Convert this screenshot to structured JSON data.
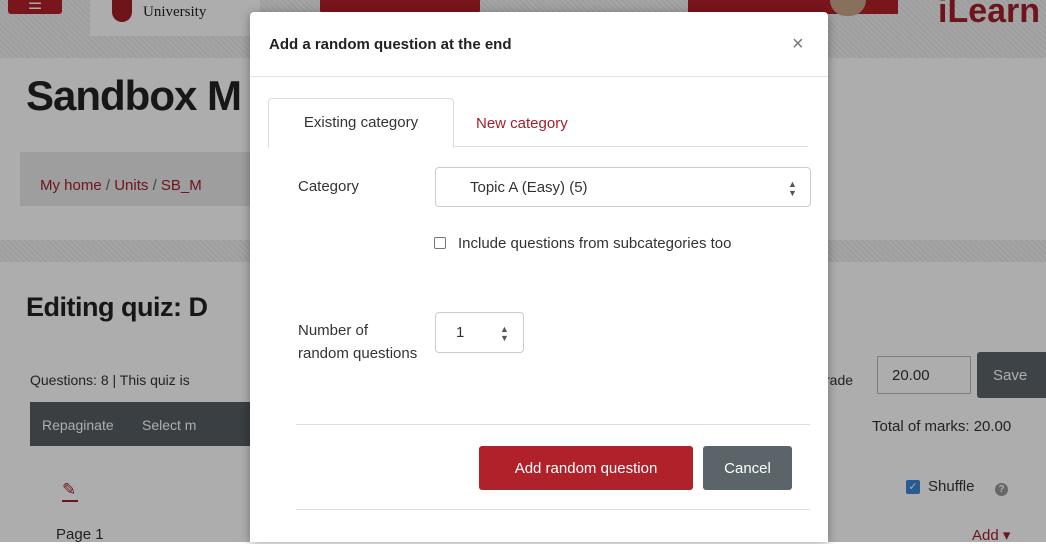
{
  "background": {
    "menu_icon": "hamburger-icon",
    "logo_text": "University",
    "brand": "iLearn",
    "page_title": "Sandbox M",
    "breadcrumb": [
      "My home",
      "Units",
      "SB_M"
    ],
    "breadcrumb_sep": "/",
    "editing_title": "Editing quiz: D",
    "questions_info": "Questions: 8 | This quiz is",
    "grade_label": "rade",
    "grade_value": "20.00",
    "save_label": "Save",
    "repaginate_label": "Repaginate",
    "select_multiple_label": "Select m",
    "total_marks": "Total of marks: 20.00",
    "shuffle_label": "Shuffle",
    "page_label": "Page 1",
    "add_label": "Add ▾"
  },
  "modal": {
    "title": "Add a random question at the end",
    "close_glyph": "×",
    "tabs": [
      {
        "label": "Existing category",
        "active": true
      },
      {
        "label": "New category",
        "active": false
      }
    ],
    "category_label": "Category",
    "category_selected": "Topic A (Easy) (5)",
    "subcategories_label": "Include questions from subcategories too",
    "subcategories_checked": false,
    "number_label": "Number of random questions",
    "number_selected": "1",
    "add_button": "Add random question",
    "cancel_button": "Cancel"
  },
  "colors": {
    "accent": "#b1212a",
    "secondary_button": "#5b6469",
    "checkbox_checked": "#3b86d3"
  }
}
